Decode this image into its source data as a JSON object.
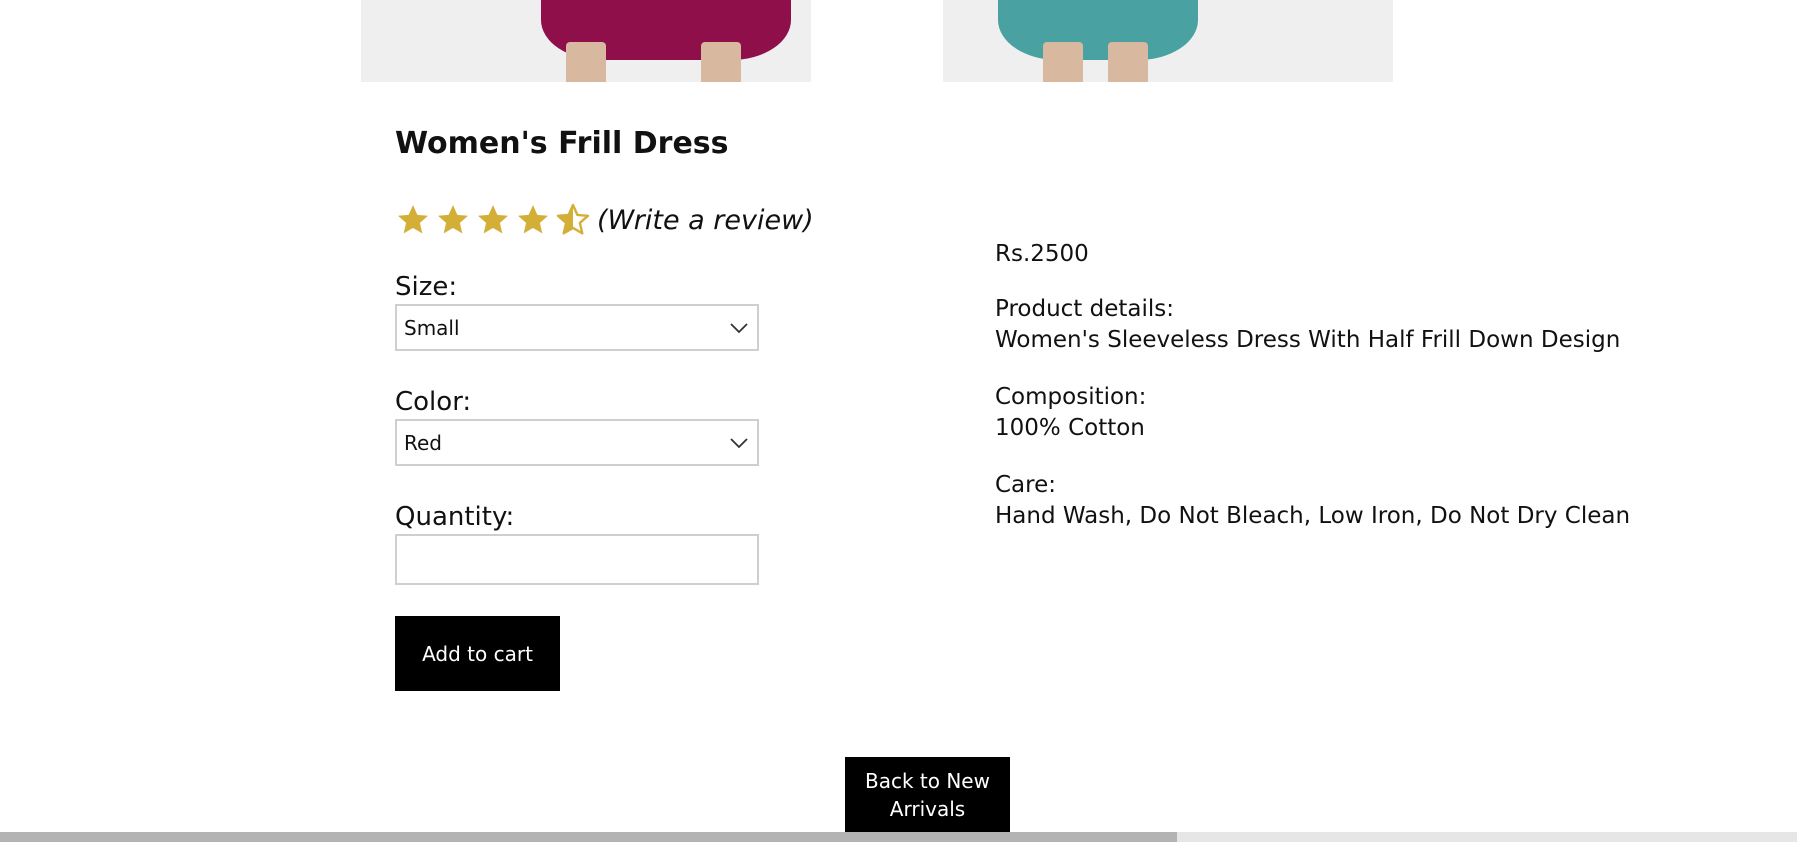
{
  "product": {
    "title": "Women's Frill Dress",
    "rating": 4.5,
    "rating_max": 5,
    "review_link": "(Write a review)",
    "price": "Rs.2500"
  },
  "options": {
    "size_label": "Size:",
    "size_value": "Small",
    "color_label": "Color:",
    "color_value": "Red",
    "quantity_label": "Quantity:",
    "quantity_value": ""
  },
  "actions": {
    "add_to_cart": "Add to cart",
    "back": "Back to New Arrivals"
  },
  "details": {
    "product_label": "Product details:",
    "product_value": "Women's Sleeveless Dress With Half Frill Down Design",
    "composition_label": "Composition:",
    "composition_value": "100% Cotton",
    "care_label": "Care:",
    "care_value": "Hand Wash, Do Not Bleach, Low Iron, Do Not Dry Clean"
  },
  "colors": {
    "star": "#D4AF37",
    "button_bg": "#000000",
    "border": "#CFCFCF"
  },
  "icons": [
    "star-icon",
    "half-star-icon",
    "chevron-down-icon"
  ],
  "scroll": {
    "position_fraction": 0.0,
    "visible_fraction": 0.655
  }
}
